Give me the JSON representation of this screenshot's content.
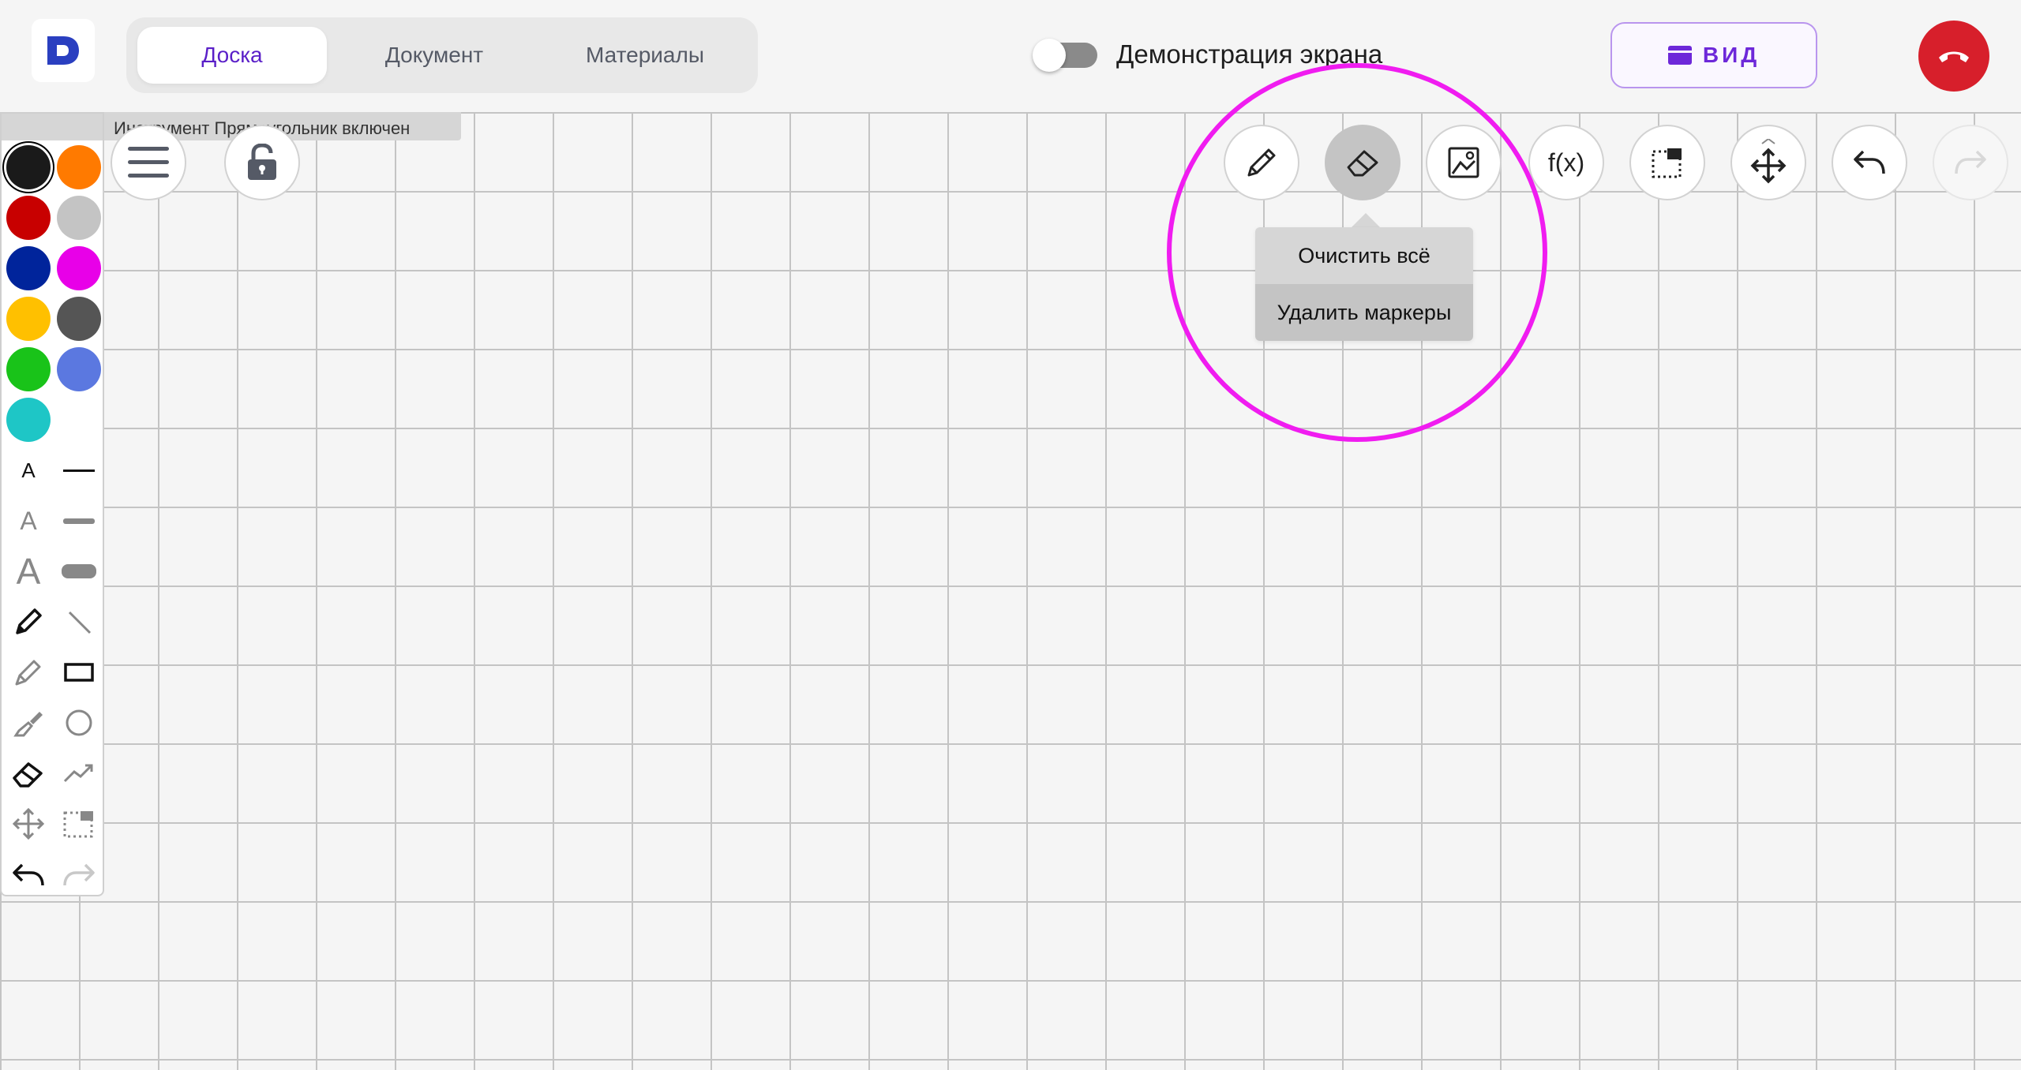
{
  "header": {
    "logo_letter": "D",
    "tabs": [
      {
        "label": "Доска",
        "active": true
      },
      {
        "label": "Документ",
        "active": false
      },
      {
        "label": "Материалы",
        "active": false
      }
    ],
    "screen_share": {
      "label": "Демонстрация экрана",
      "enabled": false
    },
    "view_button": {
      "label": "ВИД"
    },
    "hangup_button": {
      "icon": "phone-hangup-icon"
    }
  },
  "board": {
    "status_tooltip": "Инструмент Прямоугольник включен",
    "menu_button": {
      "icon": "hamburger-icon"
    },
    "lock_button": {
      "icon": "unlock-icon"
    }
  },
  "toolbox": {
    "colors": [
      "#1a1a1a",
      "#ff7a00",
      "#c80000",
      "#c4c4c4",
      "#00249b",
      "#e800e8",
      "#ffc000",
      "#555555",
      "#19c319",
      "#5b78e0",
      "#1ec6c6"
    ],
    "selected_color": "#1a1a1a",
    "text_sizes": [
      "A",
      "A",
      "A"
    ],
    "tools": [
      "pencil-icon",
      "line-icon",
      "marker-icon",
      "rectangle-icon",
      "brush-icon",
      "circle-icon",
      "eraser-icon",
      "polyline-icon",
      "move-icon",
      "select-icon",
      "undo-icon",
      "redo-icon"
    ]
  },
  "toolbar": {
    "buttons": [
      {
        "icon": "pencil-icon",
        "state": "normal"
      },
      {
        "icon": "eraser-icon",
        "state": "active"
      },
      {
        "icon": "image-icon",
        "state": "normal"
      },
      {
        "label": "f(x)",
        "icon": "formula-icon",
        "state": "normal"
      },
      {
        "icon": "select-area-icon",
        "state": "normal"
      },
      {
        "icon": "move-icon",
        "state": "normal"
      },
      {
        "icon": "undo-icon",
        "state": "normal"
      },
      {
        "icon": "redo-icon",
        "state": "disabled"
      }
    ],
    "eraser_menu": [
      "Очистить всё",
      "Удалить маркеры"
    ]
  },
  "colors": {
    "accent": "#6d28d9",
    "hangup": "#d71f2b",
    "highlight_ring": "#f01cf0",
    "grid_line": "#c4c4c4"
  }
}
